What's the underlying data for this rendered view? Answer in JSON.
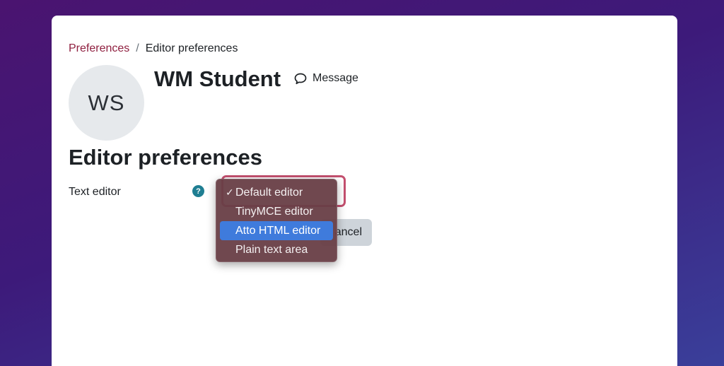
{
  "breadcrumb": {
    "parent": "Preferences",
    "separator": "/",
    "current": "Editor preferences"
  },
  "user": {
    "initials": "WS",
    "name": "WM Student",
    "message_label": "Message"
  },
  "page": {
    "heading": "Editor preferences"
  },
  "form": {
    "text_editor_label": "Text editor",
    "help_icon_glyph": "?",
    "cancel_label": "ancel"
  },
  "dropdown": {
    "check_glyph": "✓",
    "selected": "Default editor",
    "highlighted": "Atto HTML editor",
    "options": [
      "Default editor",
      "TinyMCE editor",
      "Atto HTML editor",
      "Plain text area"
    ]
  },
  "colors": {
    "link": "#8f1f3f",
    "help_icon": "#1f7e92",
    "select_border": "#c4506f",
    "menu_highlight": "#3f7bdc"
  }
}
